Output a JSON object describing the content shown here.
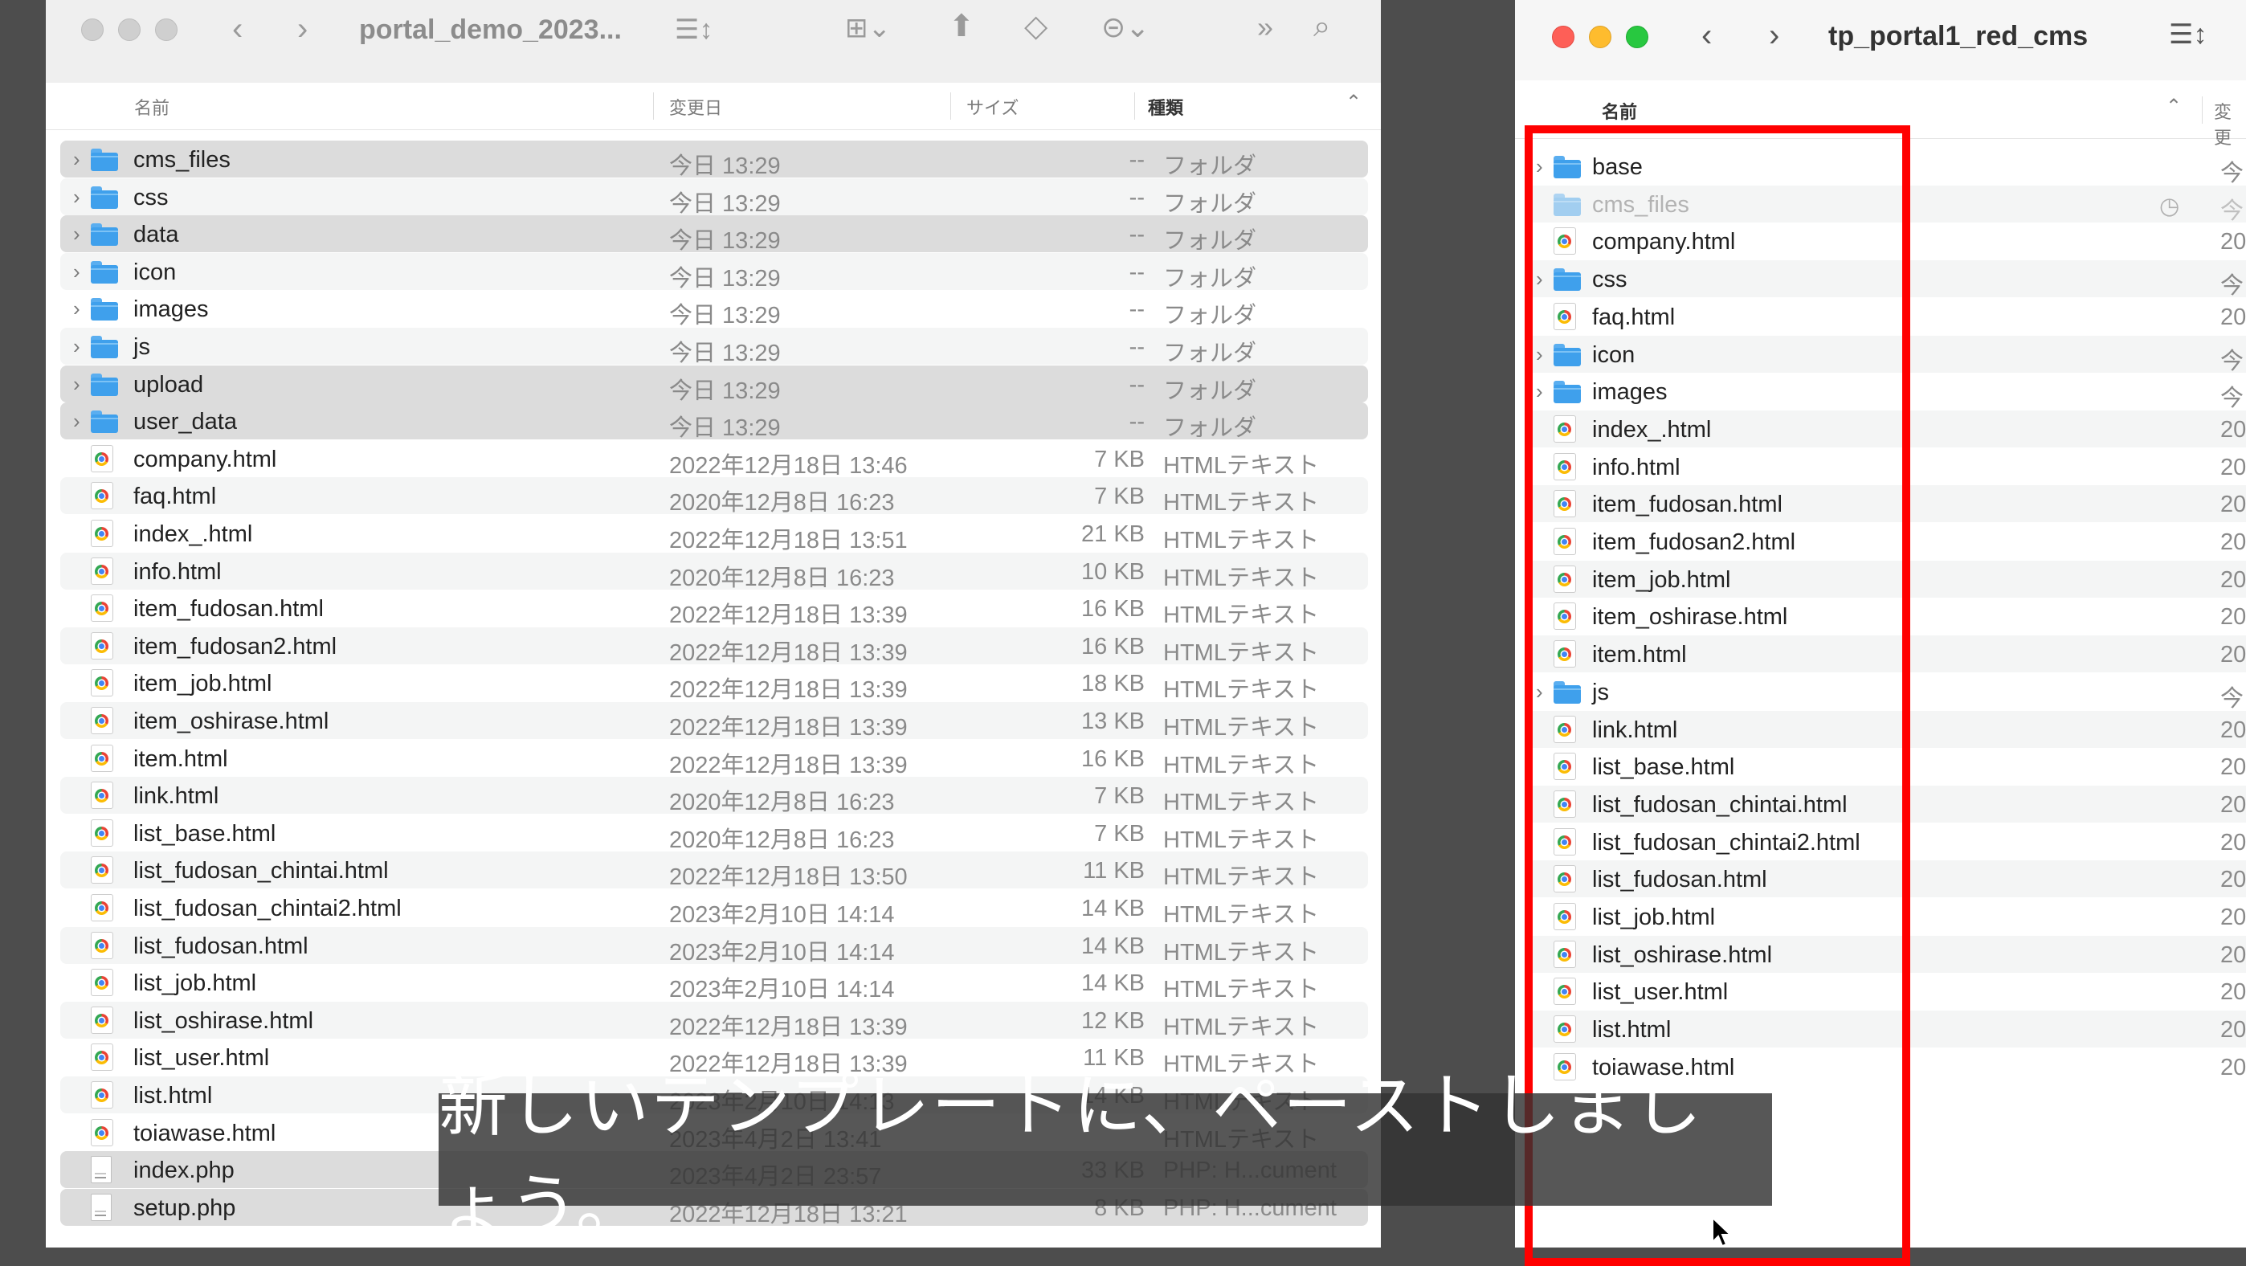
{
  "left_window": {
    "title": "portal_demo_2023...",
    "columns": {
      "name": "名前",
      "date": "変更日",
      "size": "サイズ",
      "kind": "種類"
    },
    "rows": [
      {
        "name": "cms_files",
        "date": "今日 13:29",
        "size": "--",
        "kind": "フォルダ",
        "type": "folder",
        "selected": true
      },
      {
        "name": "css",
        "date": "今日 13:29",
        "size": "--",
        "kind": "フォルダ",
        "type": "folder",
        "selected": false
      },
      {
        "name": "data",
        "date": "今日 13:29",
        "size": "--",
        "kind": "フォルダ",
        "type": "folder",
        "selected": true
      },
      {
        "name": "icon",
        "date": "今日 13:29",
        "size": "--",
        "kind": "フォルダ",
        "type": "folder",
        "selected": false
      },
      {
        "name": "images",
        "date": "今日 13:29",
        "size": "--",
        "kind": "フォルダ",
        "type": "folder",
        "selected": false
      },
      {
        "name": "js",
        "date": "今日 13:29",
        "size": "--",
        "kind": "フォルダ",
        "type": "folder",
        "selected": false
      },
      {
        "name": "upload",
        "date": "今日 13:29",
        "size": "--",
        "kind": "フォルダ",
        "type": "folder",
        "selected": true
      },
      {
        "name": "user_data",
        "date": "今日 13:29",
        "size": "--",
        "kind": "フォルダ",
        "type": "folder",
        "selected": true
      },
      {
        "name": "company.html",
        "date": "2022年12月18日 13:46",
        "size": "7 KB",
        "kind": "HTMLテキスト",
        "type": "html",
        "selected": false
      },
      {
        "name": "faq.html",
        "date": "2020年12月8日 16:23",
        "size": "7 KB",
        "kind": "HTMLテキスト",
        "type": "html",
        "selected": false
      },
      {
        "name": "index_.html",
        "date": "2022年12月18日 13:51",
        "size": "21 KB",
        "kind": "HTMLテキスト",
        "type": "html",
        "selected": false
      },
      {
        "name": "info.html",
        "date": "2020年12月8日 16:23",
        "size": "10 KB",
        "kind": "HTMLテキスト",
        "type": "html",
        "selected": false
      },
      {
        "name": "item_fudosan.html",
        "date": "2022年12月18日 13:39",
        "size": "16 KB",
        "kind": "HTMLテキスト",
        "type": "html",
        "selected": false
      },
      {
        "name": "item_fudosan2.html",
        "date": "2022年12月18日 13:39",
        "size": "16 KB",
        "kind": "HTMLテキスト",
        "type": "html",
        "selected": false
      },
      {
        "name": "item_job.html",
        "date": "2022年12月18日 13:39",
        "size": "18 KB",
        "kind": "HTMLテキスト",
        "type": "html",
        "selected": false
      },
      {
        "name": "item_oshirase.html",
        "date": "2022年12月18日 13:39",
        "size": "13 KB",
        "kind": "HTMLテキスト",
        "type": "html",
        "selected": false
      },
      {
        "name": "item.html",
        "date": "2022年12月18日 13:39",
        "size": "16 KB",
        "kind": "HTMLテキスト",
        "type": "html",
        "selected": false
      },
      {
        "name": "link.html",
        "date": "2020年12月8日 16:23",
        "size": "7 KB",
        "kind": "HTMLテキスト",
        "type": "html",
        "selected": false
      },
      {
        "name": "list_base.html",
        "date": "2020年12月8日 16:23",
        "size": "7 KB",
        "kind": "HTMLテキスト",
        "type": "html",
        "selected": false
      },
      {
        "name": "list_fudosan_chintai.html",
        "date": "2022年12月18日 13:50",
        "size": "11 KB",
        "kind": "HTMLテキスト",
        "type": "html",
        "selected": false
      },
      {
        "name": "list_fudosan_chintai2.html",
        "date": "2023年2月10日 14:14",
        "size": "14 KB",
        "kind": "HTMLテキスト",
        "type": "html",
        "selected": false
      },
      {
        "name": "list_fudosan.html",
        "date": "2023年2月10日 14:14",
        "size": "14 KB",
        "kind": "HTMLテキスト",
        "type": "html",
        "selected": false
      },
      {
        "name": "list_job.html",
        "date": "2023年2月10日 14:14",
        "size": "14 KB",
        "kind": "HTMLテキスト",
        "type": "html",
        "selected": false
      },
      {
        "name": "list_oshirase.html",
        "date": "2022年12月18日 13:39",
        "size": "12 KB",
        "kind": "HTMLテキスト",
        "type": "html",
        "selected": false
      },
      {
        "name": "list_user.html",
        "date": "2022年12月18日 13:39",
        "size": "11 KB",
        "kind": "HTMLテキスト",
        "type": "html",
        "selected": false
      },
      {
        "name": "list.html",
        "date": "2023年2月10日 14:13",
        "size": "14 KB",
        "kind": "HTMLテキスト",
        "type": "html",
        "selected": false
      },
      {
        "name": "toiawase.html",
        "date": "2023年4月2日 13:41",
        "size": "",
        "kind": "HTMLテキスト",
        "type": "html",
        "selected": false
      },
      {
        "name": "index.php",
        "date": "2023年4月2日 23:57",
        "size": "33 KB",
        "kind": "PHP: H...cument",
        "type": "php",
        "selected": true
      },
      {
        "name": "setup.php",
        "date": "2022年12月18日 13:21",
        "size": "8 KB",
        "kind": "PHP: H...cument",
        "type": "php",
        "selected": true
      }
    ]
  },
  "right_window": {
    "title": "tp_portal1_red_cms",
    "columns": {
      "name": "名前",
      "date": "変更"
    },
    "rows": [
      {
        "name": "base",
        "date": "今日",
        "type": "folder",
        "expandable": true,
        "dim": false
      },
      {
        "name": "cms_files",
        "date": "今日",
        "type": "folder",
        "expandable": false,
        "dim": true
      },
      {
        "name": "company.html",
        "date": "20",
        "type": "html",
        "expandable": false,
        "dim": false
      },
      {
        "name": "css",
        "date": "今日",
        "type": "folder",
        "expandable": true,
        "dim": false
      },
      {
        "name": "faq.html",
        "date": "20",
        "type": "html",
        "expandable": false,
        "dim": false
      },
      {
        "name": "icon",
        "date": "今日",
        "type": "folder",
        "expandable": true,
        "dim": false
      },
      {
        "name": "images",
        "date": "今日",
        "type": "folder",
        "expandable": true,
        "dim": false
      },
      {
        "name": "index_.html",
        "date": "20",
        "type": "html",
        "expandable": false,
        "dim": false
      },
      {
        "name": "info.html",
        "date": "20",
        "type": "html",
        "expandable": false,
        "dim": false
      },
      {
        "name": "item_fudosan.html",
        "date": "20",
        "type": "html",
        "expandable": false,
        "dim": false
      },
      {
        "name": "item_fudosan2.html",
        "date": "20",
        "type": "html",
        "expandable": false,
        "dim": false
      },
      {
        "name": "item_job.html",
        "date": "20",
        "type": "html",
        "expandable": false,
        "dim": false
      },
      {
        "name": "item_oshirase.html",
        "date": "20",
        "type": "html",
        "expandable": false,
        "dim": false
      },
      {
        "name": "item.html",
        "date": "20",
        "type": "html",
        "expandable": false,
        "dim": false
      },
      {
        "name": "js",
        "date": "今日",
        "type": "folder",
        "expandable": true,
        "dim": false
      },
      {
        "name": "link.html",
        "date": "20",
        "type": "html",
        "expandable": false,
        "dim": false
      },
      {
        "name": "list_base.html",
        "date": "20",
        "type": "html",
        "expandable": false,
        "dim": false
      },
      {
        "name": "list_fudosan_chintai.html",
        "date": "20",
        "type": "html",
        "expandable": false,
        "dim": false
      },
      {
        "name": "list_fudosan_chintai2.html",
        "date": "20",
        "type": "html",
        "expandable": false,
        "dim": false
      },
      {
        "name": "list_fudosan.html",
        "date": "20",
        "type": "html",
        "expandable": false,
        "dim": false
      },
      {
        "name": "list_job.html",
        "date": "20",
        "type": "html",
        "expandable": false,
        "dim": false
      },
      {
        "name": "list_oshirase.html",
        "date": "20",
        "type": "html",
        "expandable": false,
        "dim": false
      },
      {
        "name": "list_user.html",
        "date": "20",
        "type": "html",
        "expandable": false,
        "dim": false
      },
      {
        "name": "list.html",
        "date": "20",
        "type": "html",
        "expandable": false,
        "dim": false
      },
      {
        "name": "toiawase.html",
        "date": "20",
        "type": "html",
        "expandable": false,
        "dim": false
      }
    ]
  },
  "subtitle": "新しいテンプレートに、ペーストしましょう。",
  "colors": {
    "selection": "#dcdcdc",
    "highlight_box": "#ff0000",
    "folder": "#3fa0ec",
    "zebra": "#f4f5f5"
  },
  "icons": {
    "back": "chevron-left-icon",
    "forward": "chevron-right-icon",
    "list_view": "list-view-icon",
    "group": "grid-view-icon",
    "share": "share-icon",
    "tag": "tag-icon",
    "action": "ellipsis-circle-icon",
    "more": "double-chevron-icon",
    "search": "search-icon"
  }
}
